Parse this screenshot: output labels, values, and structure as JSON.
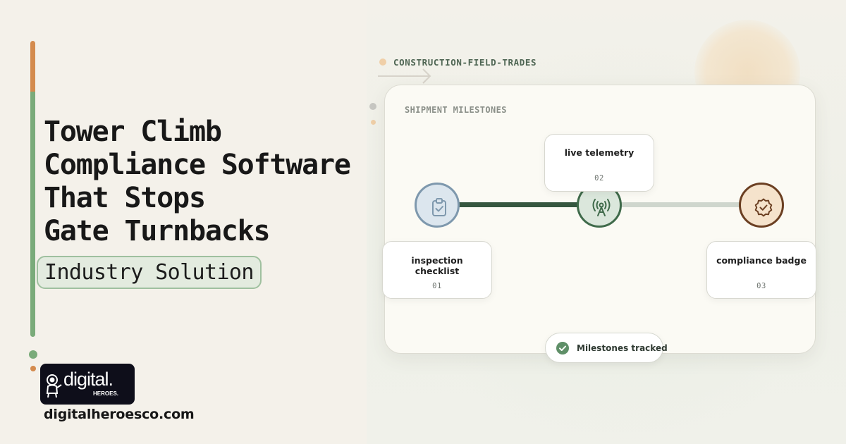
{
  "hero": {
    "headline_lines": [
      "Tower Climb",
      "Compliance Software",
      "That Stops",
      "Gate Turnbacks"
    ],
    "tag": "Industry Solution"
  },
  "brand": {
    "logo_word": "digital.",
    "logo_sub": "HEROES.",
    "url": "digitalheroesco.com"
  },
  "industry": {
    "label": "CONSTRUCTION-FIELD-TRADES"
  },
  "tracker": {
    "title": "SHIPMENT MILESTONES",
    "milestones": [
      {
        "label": "inspection checklist",
        "number": "01",
        "icon": "clipboard-check-icon",
        "state": "done"
      },
      {
        "label": "live telemetry",
        "number": "02",
        "icon": "antenna-icon",
        "state": "current"
      },
      {
        "label": "compliance badge",
        "number": "03",
        "icon": "badge-check-icon",
        "state": "pending"
      }
    ],
    "status_text": "Milestones tracked",
    "status_icon": "check-circle-icon"
  },
  "colors": {
    "accent_orange": "#d48b4e",
    "accent_green": "#7aab7a",
    "track_done": "#35563f",
    "track_pending": "#cfd6cd"
  }
}
